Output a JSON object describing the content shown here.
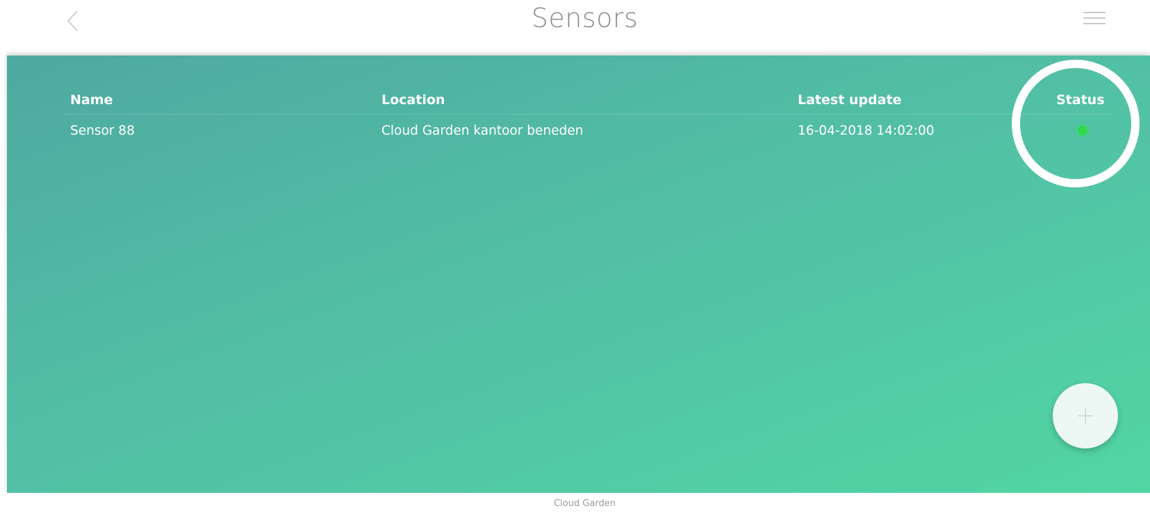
{
  "header": {
    "title": "Sensors",
    "back_icon": "chevron-left-icon",
    "menu_icon": "hamburger-menu-icon"
  },
  "table": {
    "columns": {
      "name": "Name",
      "location": "Location",
      "latest_update": "Latest update",
      "status": "Status"
    },
    "rows": [
      {
        "name": "Sensor 88",
        "location": "Cloud Garden kantoor beneden",
        "latest_update": "16-04-2018 14:02:00",
        "status": "online"
      }
    ]
  },
  "fab": {
    "icon": "plus-icon"
  },
  "footer": {
    "text": "Cloud Garden"
  },
  "colors": {
    "gradient_start": "#4ea9a0",
    "gradient_end": "#52d6a4",
    "status_online": "#2fd84e",
    "title_text": "#8a8a8a"
  }
}
